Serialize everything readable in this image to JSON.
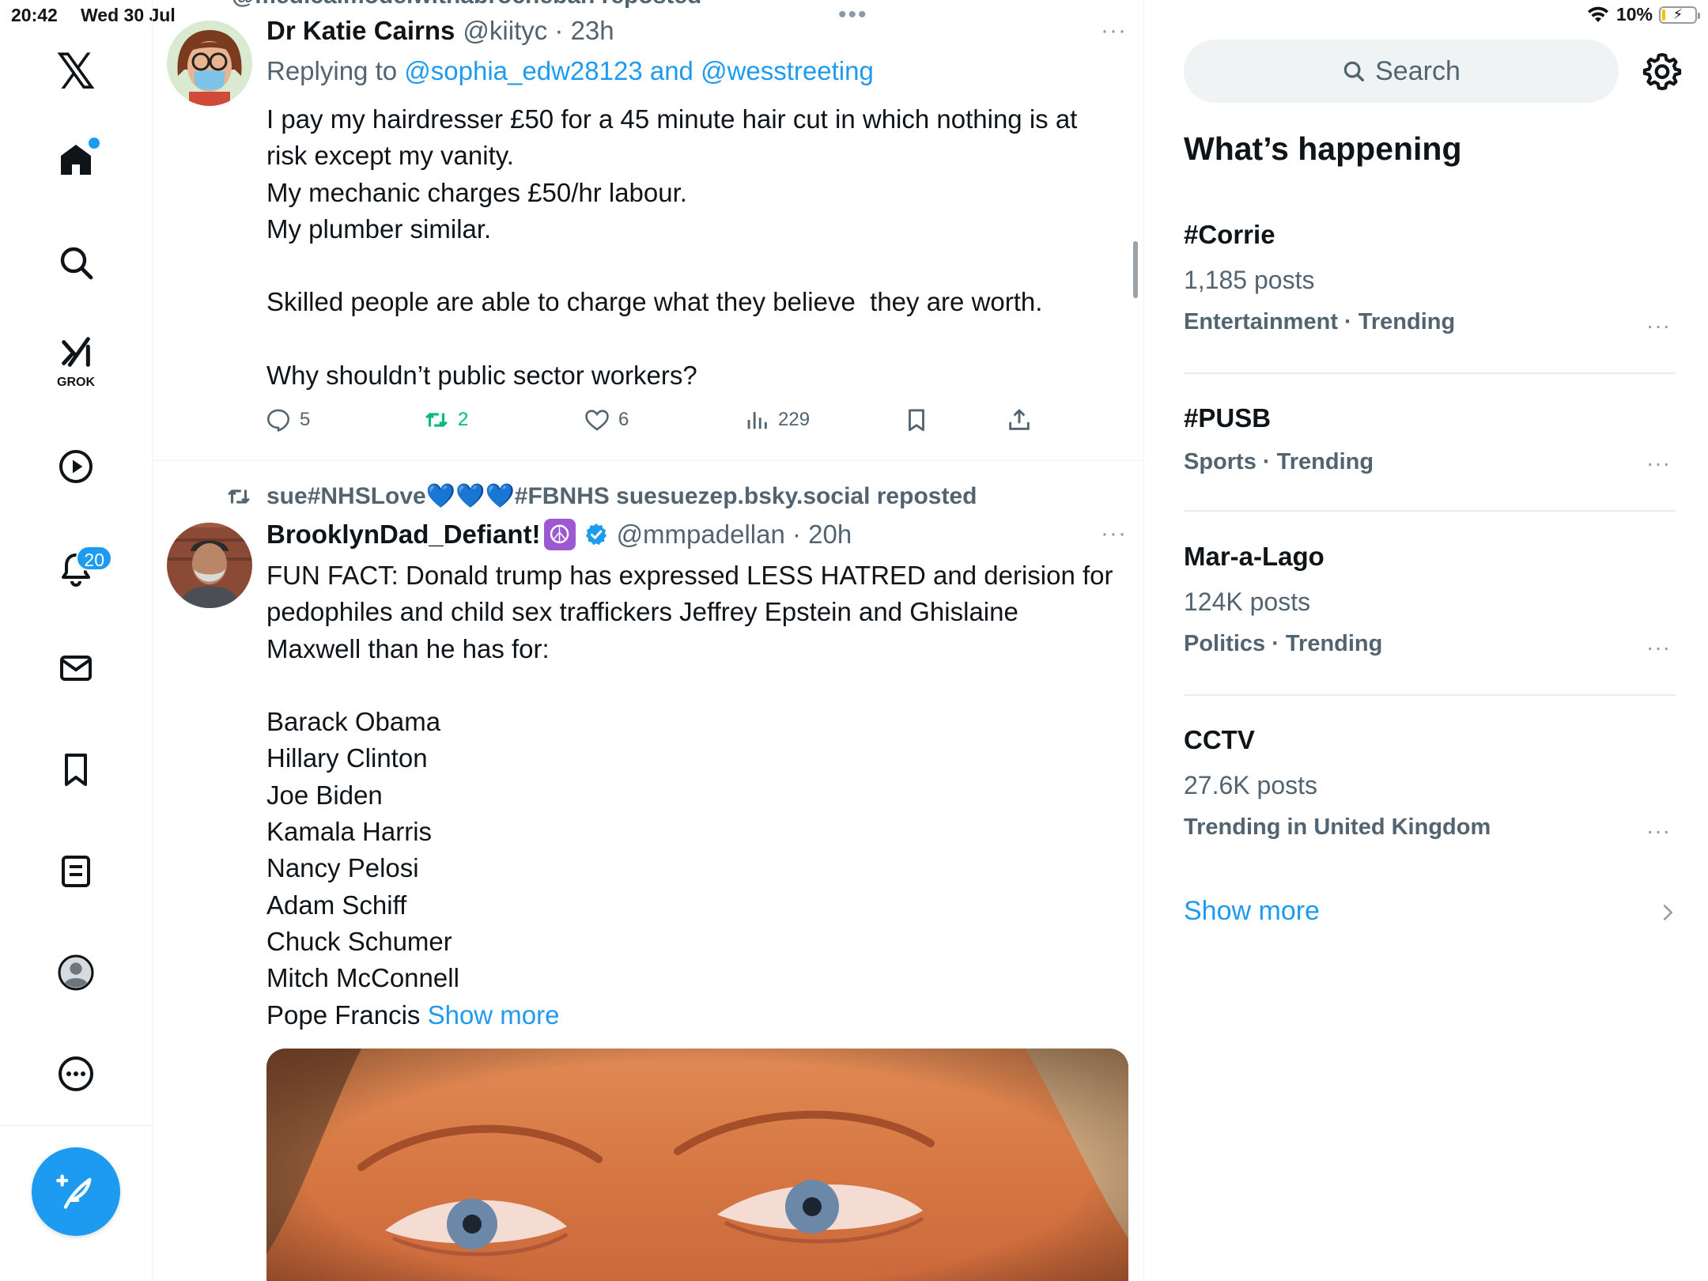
{
  "status_bar": {
    "time": "20:42",
    "date": "Wed 30 Jul",
    "battery": "10%",
    "battery_level": 0.1
  },
  "nav": {
    "logo": "𝕏",
    "items": [
      {
        "icon": "home-icon"
      },
      {
        "icon": "search-icon"
      },
      {
        "icon": "grok-icon",
        "label": "GROK"
      },
      {
        "icon": "video-icon"
      },
      {
        "icon": "notifications-icon",
        "badge": "20"
      },
      {
        "icon": "messages-icon"
      },
      {
        "icon": "bookmarks-icon"
      },
      {
        "icon": "lists-icon"
      },
      {
        "icon": "profile-icon"
      },
      {
        "icon": "more-icon"
      }
    ],
    "compose_icon": "compose-post-icon"
  },
  "timeline": {
    "top_partial": "@medicalmodelwithabrocheban reposted",
    "pull_dots": "•••",
    "tweets": [
      {
        "name": "Dr Katie Cairns",
        "handle": "@kiityc · 23h",
        "more": "···",
        "replying_prefix": "Replying to",
        "replying_to": "@sophia_edw28123 and @wesstreeting",
        "body": "I pay my hairdresser £50 for a 45 minute hair cut in which nothing is at\nrisk except my vanity.\nMy mechanic charges £50/hr labour.\nMy plumber similar.\n\nSkilled people are able to charge what they believe  they are worth.\n\nWhy shouldn’t public sector workers?",
        "replies": "5",
        "reposts": "2",
        "likes": "6",
        "views": "229"
      },
      {
        "reposted_by": "sue#NHSLove💙💙💙#FBNHS suesuezep.bsky.social reposted",
        "name": "BrooklynDad_Defiant!",
        "name_emoji": "☮",
        "handle": "@mmpadellan · 20h",
        "more": "···",
        "body": "FUN FACT: Donald trump has expressed LESS HATRED and derision for\npedophiles and child sex traffickers Jeffrey Epstein and Ghislaine\nMaxwell than he has for:\n\nBarack Obama\nHillary Clinton\nJoe Biden\nKamala Harris\nNancy Pelosi\nAdam Schiff\nChuck Schumer\nMitch McConnell\nPope Francis ",
        "show_more": "Show more"
      }
    ]
  },
  "sidebar": {
    "search_placeholder": "Search",
    "title": "What’s happening",
    "trends": [
      {
        "name": "#Corrie",
        "count": "1,185 posts",
        "meta": "Entertainment · Trending"
      },
      {
        "name": "#PUSB",
        "meta": "Sports · Trending"
      },
      {
        "name": "Mar-a-Lago",
        "count": "124K posts",
        "meta": "Politics · Trending"
      },
      {
        "name": "CCTV",
        "count": "27.6K posts",
        "meta": "Trending in United Kingdom"
      }
    ],
    "trend_more": "···",
    "show_more": "Show more"
  },
  "colors": {
    "accent": "#1d9bf0",
    "repost_green": "#00ba7c",
    "muted": "#536471",
    "text": "#0f1419"
  }
}
